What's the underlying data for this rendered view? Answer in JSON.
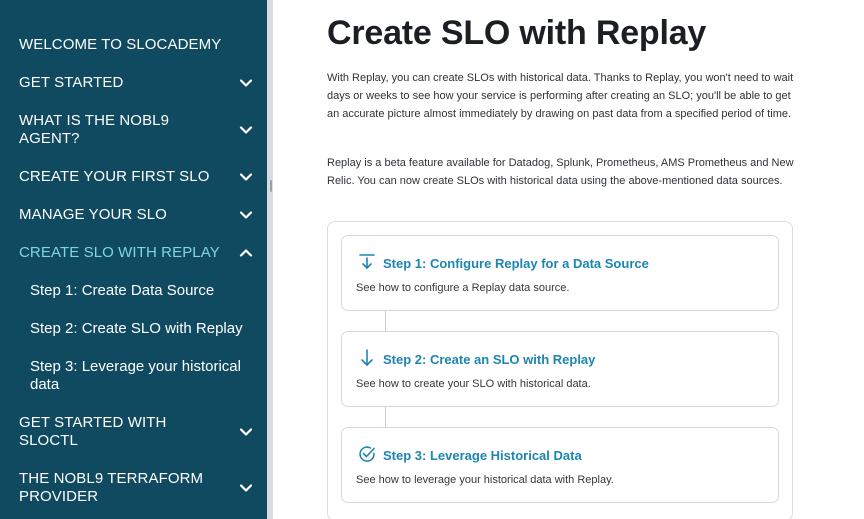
{
  "sidebar": {
    "items": [
      {
        "label": "WELCOME TO SLOCADEMY"
      },
      {
        "label": "GET STARTED"
      },
      {
        "label": "WHAT IS THE NOBL9 AGENT?"
      },
      {
        "label": "CREATE YOUR FIRST SLO"
      },
      {
        "label": "MANAGE YOUR SLO"
      },
      {
        "label": "CREATE SLO WITH REPLAY"
      },
      {
        "label": "GET STARTED WITH SLOCTL"
      },
      {
        "label": "THE NOBL9 TERRAFORM PROVIDER"
      }
    ],
    "subitems": [
      {
        "label": "Step 1: Create Data Source"
      },
      {
        "label": "Step 2: Create SLO with Replay"
      },
      {
        "label": "Step 3: Leverage your historical data"
      }
    ],
    "active_color": "#7fd6e3",
    "background": "#0f4a61"
  },
  "main": {
    "title": "Create SLO with Replay",
    "paragraphs": [
      "With Replay, you can create SLOs with historical data. Thanks to Replay, you won't need to wait days or weeks to see how your service is performing after creating an SLO; you'll be able to get an accurate picture almost immediately by drawing on past data from a specified period of time.",
      "Replay is a beta feature available for Datadog, Splunk, Prometheus, AMS Prometheus and New Relic. You can now create SLOs with historical data using the above-mentioned data sources."
    ],
    "steps": [
      {
        "icon": "arrow-down-to-line-icon",
        "title": "Step 1: Configure Replay for a Data Source",
        "description": "See how to configure a Replay data source."
      },
      {
        "icon": "arrow-down-icon",
        "title": "Step 2: Create an SLO with Replay",
        "description": "See how to create your SLO with historical data."
      },
      {
        "icon": "check-circle-icon",
        "title": "Step 3: Leverage Historical Data",
        "description": "See how to leverage your historical data with Replay."
      }
    ],
    "accent_color": "#1c86b0"
  }
}
